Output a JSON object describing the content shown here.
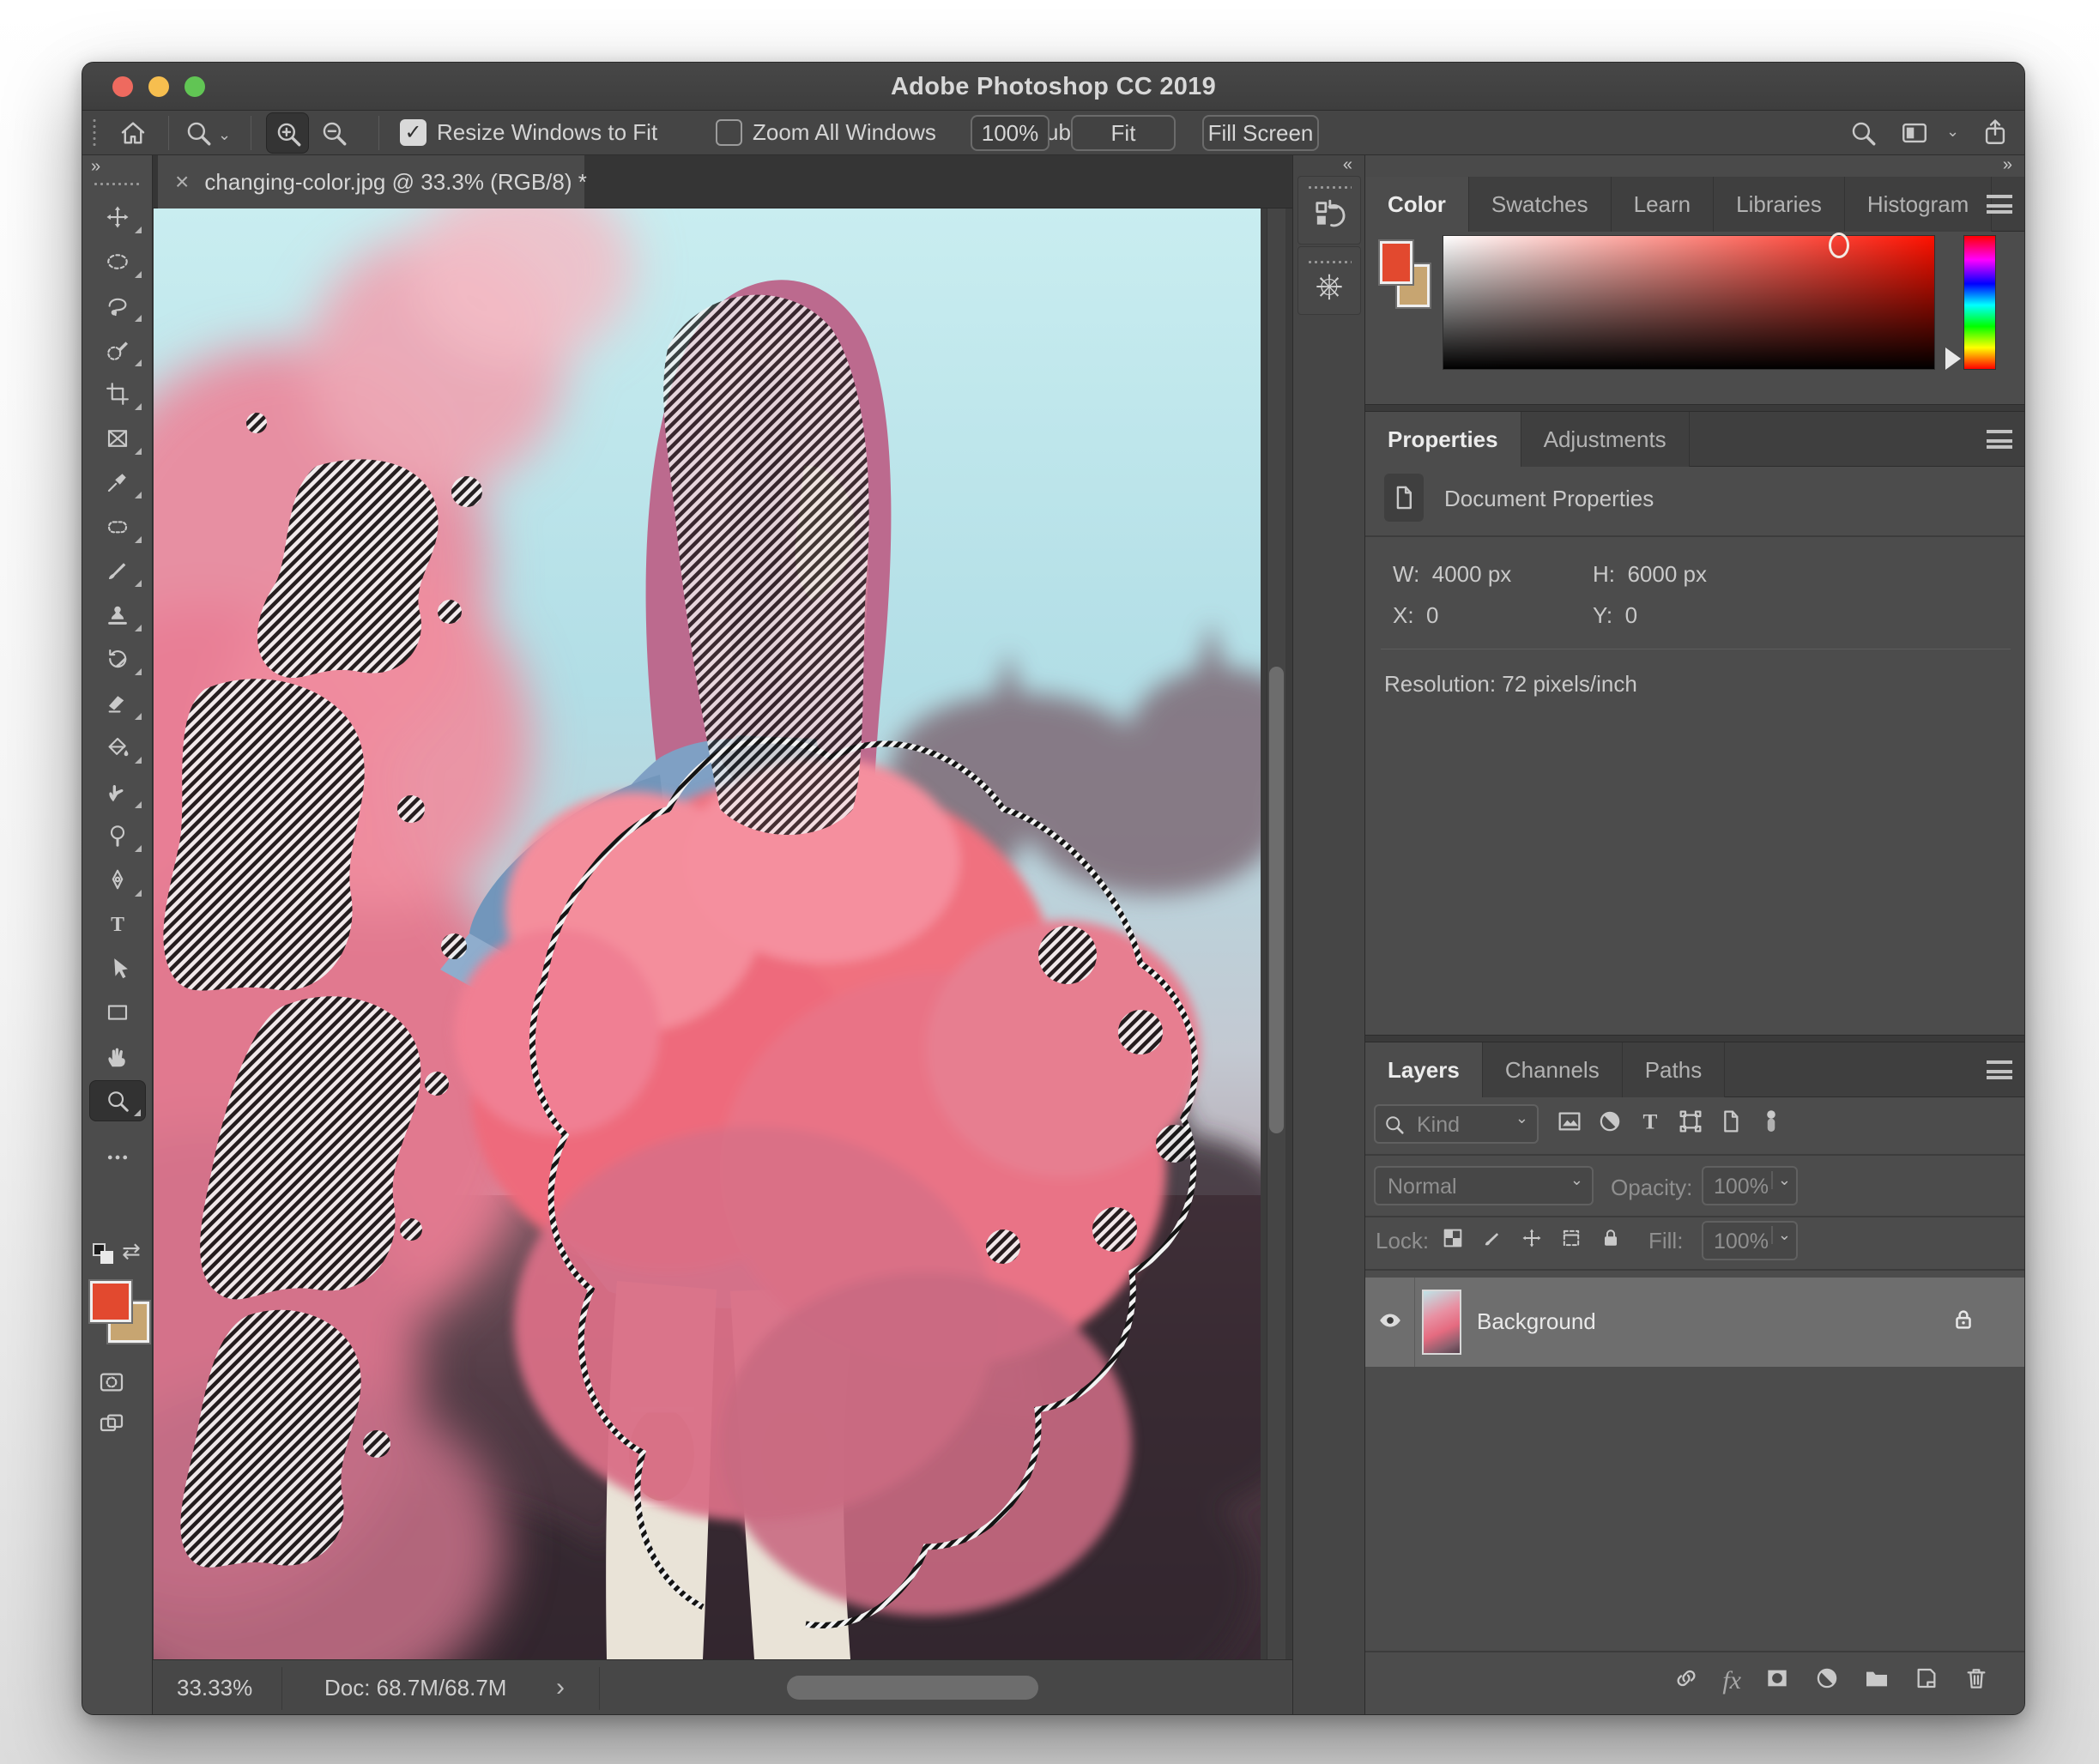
{
  "window": {
    "title": "Adobe Photoshop CC 2019",
    "traffic_lights": [
      "close",
      "minimize",
      "zoom"
    ],
    "traffic_colors": [
      "#ee6a5f",
      "#f6be4f",
      "#61c554"
    ]
  },
  "options_bar": {
    "tool_icons": [
      "home",
      "zoom-tool",
      "zoom-in",
      "zoom-out"
    ],
    "checkboxes": [
      {
        "label": "Resize Windows to Fit",
        "checked": true
      },
      {
        "label": "Zoom All Windows",
        "checked": false
      },
      {
        "label": "Scrubby Zoom",
        "checked": true
      }
    ],
    "zoom_value": "100%",
    "buttons": [
      "Fit Screen",
      "Fill Screen"
    ],
    "right_icons": [
      "search",
      "workspace-switcher",
      "chevron-down",
      "share"
    ]
  },
  "toolbar": {
    "tools": [
      "move",
      "elliptical-marquee",
      "lasso",
      "quick-selection",
      "crop",
      "frame",
      "eyedropper",
      "patch",
      "brush",
      "clone-stamp",
      "history-brush",
      "eraser",
      "paint-bucket",
      "smudge",
      "dodge",
      "pen",
      "type",
      "path-select",
      "rectangle",
      "hand",
      "zoom",
      "edit-toolbar"
    ],
    "selected_tool": "zoom",
    "type_glyph": "T",
    "foreground_color": "#e2492f",
    "background_color": "#c7a571",
    "extra": [
      "swap-colors",
      "default-colors",
      "quick-mask",
      "screen-mode"
    ]
  },
  "document": {
    "tab": {
      "close": "×",
      "title": "changing-color.jpg @ 33.3% (RGB/8) *"
    },
    "status": {
      "zoom": "33.33%",
      "doc": "Doc: 68.7M/68.7M",
      "chevron": "›"
    }
  },
  "dock": {
    "collapse": "<<",
    "expand": ">>",
    "panel_icons": [
      "history",
      "navigator-wheel"
    ]
  },
  "color_panel": {
    "tabs": [
      "Color",
      "Swatches",
      "Learn",
      "Libraries",
      "Histogram"
    ],
    "active_tab": "Color"
  },
  "properties_panel": {
    "tabs": [
      "Properties",
      "Adjustments"
    ],
    "active_tab": "Properties",
    "section_title": "Document Properties",
    "fields": {
      "w_label": "W:",
      "w_value": "4000 px",
      "h_label": "H:",
      "h_value": "6000 px",
      "x_label": "X:",
      "x_value": "0",
      "y_label": "Y:",
      "y_value": "0"
    },
    "resolution": "Resolution: 72 pixels/inch"
  },
  "layers_panel": {
    "tabs": [
      "Layers",
      "Channels",
      "Paths"
    ],
    "active_tab": "Layers",
    "kind_label": "Kind",
    "filter_icons": [
      "image",
      "adjustment",
      "type",
      "shape",
      "smart-object",
      "filter-toggle"
    ],
    "blend_mode": "Normal",
    "opacity_label": "Opacity:",
    "opacity_value": "100%",
    "lock_label": "Lock:",
    "lock_icons": [
      "checkerboard",
      "brush",
      "move",
      "frame",
      "lock"
    ],
    "fill_label": "Fill:",
    "fill_value": "100%",
    "layers": [
      {
        "name": "Background",
        "visible": true,
        "locked": true
      }
    ],
    "fx_label": "fx",
    "bottom_icons": [
      "link",
      "fx",
      "mask",
      "adjustment",
      "folder",
      "new-layer",
      "trash"
    ]
  }
}
